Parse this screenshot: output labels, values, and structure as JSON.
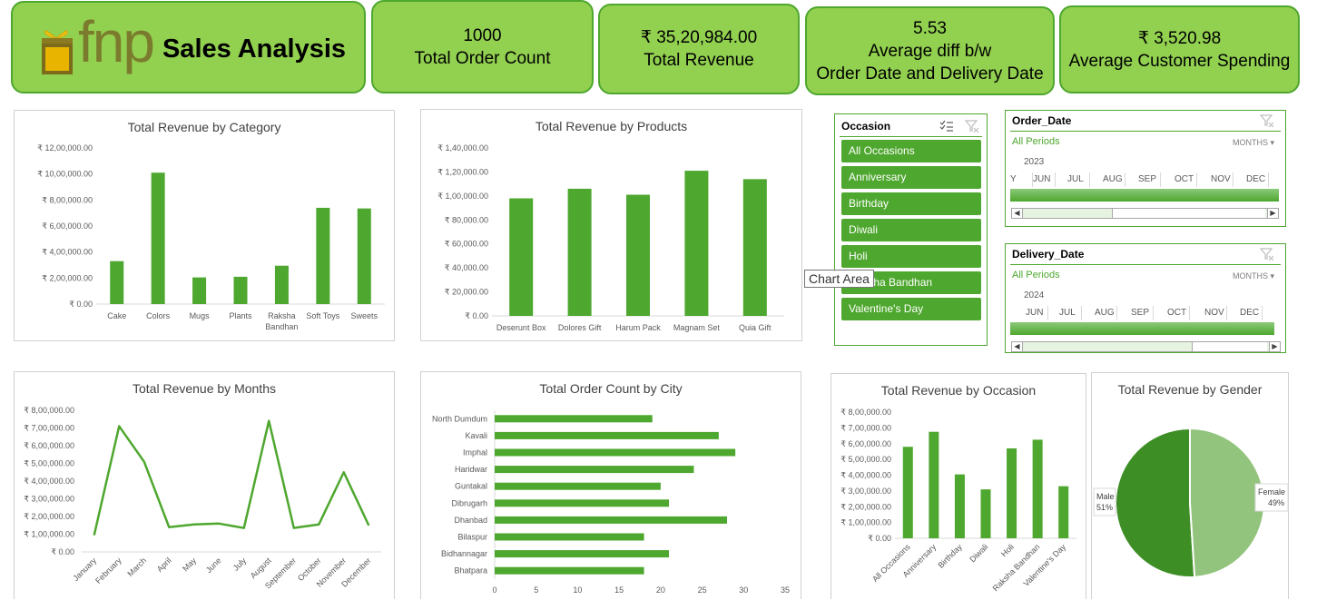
{
  "header": {
    "brand": "fnp",
    "title": "Sales Analysis"
  },
  "kpis": [
    {
      "value": "1000",
      "label": "Total Order Count"
    },
    {
      "value": "₹ 35,20,984.00",
      "label": "Total Revenue"
    },
    {
      "value": "5.53",
      "label": "Average diff b/w",
      "label2": "Order Date and Delivery Date"
    },
    {
      "value": "₹ 3,520.98",
      "label": "Average Customer Spending"
    }
  ],
  "colors": {
    "accent": "#4ea72e",
    "kpi_bg": "#92d050",
    "light": "#92c47d"
  },
  "occasion_slicer": {
    "title": "Occasion",
    "items": [
      "All Occasions",
      "Anniversary",
      "Birthday",
      "Diwali",
      "Holi",
      "Raksha Bandhan",
      "Valentine's Day"
    ]
  },
  "tooltip": "Chart Area",
  "order_timeline": {
    "title": "Order_Date",
    "all_periods": "All Periods",
    "level": "MONTHS",
    "year": "2023",
    "months": [
      "Y",
      "JUN",
      "JUL",
      "AUG",
      "SEP",
      "OCT",
      "NOV",
      "DEC"
    ]
  },
  "delivery_timeline": {
    "title": "Delivery_Date",
    "all_periods": "All Periods",
    "level": "MONTHS",
    "year": "2024",
    "months": [
      "JUN",
      "JUL",
      "AUG",
      "SEP",
      "OCT",
      "NOV",
      "DEC"
    ]
  },
  "chart_data": [
    {
      "id": "category",
      "type": "bar",
      "title": "Total Revenue by Category",
      "categories": [
        "Cake",
        "Colors",
        "Mugs",
        "Plants",
        "Raksha Bandhan",
        "Soft Toys",
        "Sweets"
      ],
      "values": [
        330000,
        1010000,
        205000,
        210000,
        295000,
        740000,
        735000
      ],
      "ylim": [
        0,
        1200000
      ],
      "yticks": [
        "₹ 0.00",
        "₹ 2,00,000.00",
        "₹ 4,00,000.00",
        "₹ 6,00,000.00",
        "₹ 8,00,000.00",
        "₹ 10,00,000.00",
        "₹ 12,00,000.00"
      ]
    },
    {
      "id": "products",
      "type": "bar",
      "title": "Total Revenue by Products",
      "categories": [
        "Deserunt Box",
        "Dolores Gift",
        "Harum Pack",
        "Magnam Set",
        "Quia Gift"
      ],
      "values": [
        98000,
        106000,
        101000,
        121000,
        114000
      ],
      "ylim": [
        0,
        140000
      ],
      "yticks": [
        "₹ 0.00",
        "₹ 20,000.00",
        "₹ 40,000.00",
        "₹ 60,000.00",
        "₹ 80,000.00",
        "₹ 1,00,000.00",
        "₹ 1,20,000.00",
        "₹ 1,40,000.00"
      ]
    },
    {
      "id": "months",
      "type": "line",
      "title": "Total Revenue by Months",
      "categories": [
        "January",
        "February",
        "March",
        "April",
        "May",
        "June",
        "July",
        "August",
        "September",
        "October",
        "November",
        "December"
      ],
      "values": [
        95000,
        710000,
        510000,
        140000,
        155000,
        160000,
        135000,
        740000,
        135000,
        155000,
        450000,
        150000
      ],
      "ylim": [
        0,
        800000
      ],
      "yticks": [
        "₹ 0.00",
        "₹ 1,00,000.00",
        "₹ 2,00,000.00",
        "₹ 3,00,000.00",
        "₹ 4,00,000.00",
        "₹ 5,00,000.00",
        "₹ 6,00,000.00",
        "₹ 7,00,000.00",
        "₹ 8,00,000.00"
      ]
    },
    {
      "id": "city",
      "type": "bar",
      "title": "Total Order Count by City",
      "categories": [
        "North Dumdum",
        "Kavali",
        "Imphal",
        "Haridwar",
        "Guntakal",
        "Dibrugarh",
        "Dhanbad",
        "Bilaspur",
        "Bidhannagar",
        "Bhatpara"
      ],
      "values": [
        19,
        27,
        29,
        24,
        20,
        21,
        28,
        18,
        21,
        18
      ],
      "xlim": [
        0,
        35
      ],
      "xticks": [
        "0",
        "5",
        "10",
        "15",
        "20",
        "25",
        "30",
        "35"
      ]
    },
    {
      "id": "occasion",
      "type": "bar",
      "title": "Total Revenue by Occasion",
      "categories": [
        "All Occasions",
        "Anniversary",
        "Birthday",
        "Diwali",
        "Holi",
        "Raksha Bandhan",
        "Valentine's Day"
      ],
      "values": [
        580000,
        675000,
        405000,
        310000,
        570000,
        625000,
        330000
      ],
      "ylim": [
        0,
        800000
      ],
      "yticks": [
        "₹ 0.00",
        "₹ 1,00,000.00",
        "₹ 2,00,000.00",
        "₹ 3,00,000.00",
        "₹ 4,00,000.00",
        "₹ 5,00,000.00",
        "₹ 6,00,000.00",
        "₹ 7,00,000.00",
        "₹ 8,00,000.00"
      ]
    },
    {
      "id": "gender",
      "type": "pie",
      "title": "Total Revenue by Gender",
      "slices": [
        {
          "name": "Male",
          "label": "51%",
          "value": 51,
          "color": "#3e8e26"
        },
        {
          "name": "Female",
          "label": "49%",
          "value": 49,
          "color": "#92c47d"
        }
      ]
    }
  ]
}
